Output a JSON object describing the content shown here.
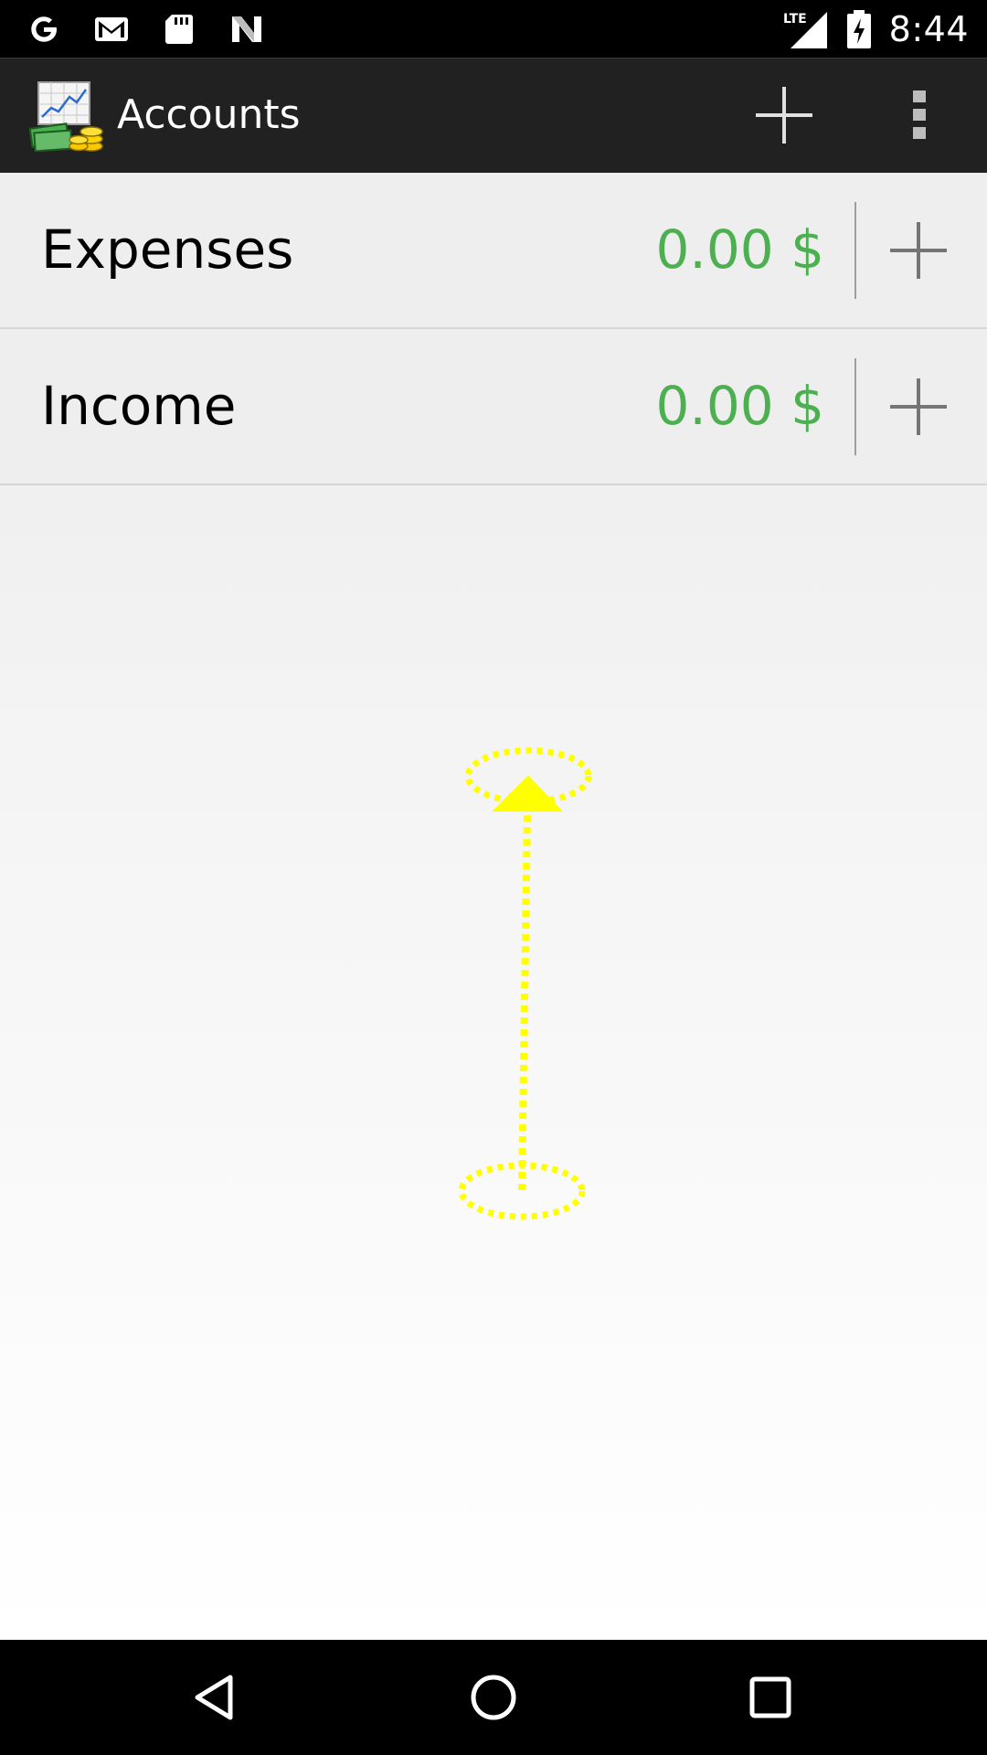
{
  "status_bar": {
    "time": "8:44",
    "network": "LTE",
    "notification_icons": [
      "google-icon",
      "gmail-icon",
      "sd-card-icon",
      "n-icon"
    ]
  },
  "action_bar": {
    "title": "Accounts"
  },
  "accounts": [
    {
      "name": "Expenses",
      "amount": "0.00 $"
    },
    {
      "name": "Income",
      "amount": "0.00 $"
    }
  ],
  "colors": {
    "amount": "#4caf50",
    "action_bar": "#212121",
    "gesture": "#ffff00"
  },
  "nav_bar": {
    "icons": [
      "back-icon",
      "home-icon",
      "recents-icon"
    ]
  }
}
